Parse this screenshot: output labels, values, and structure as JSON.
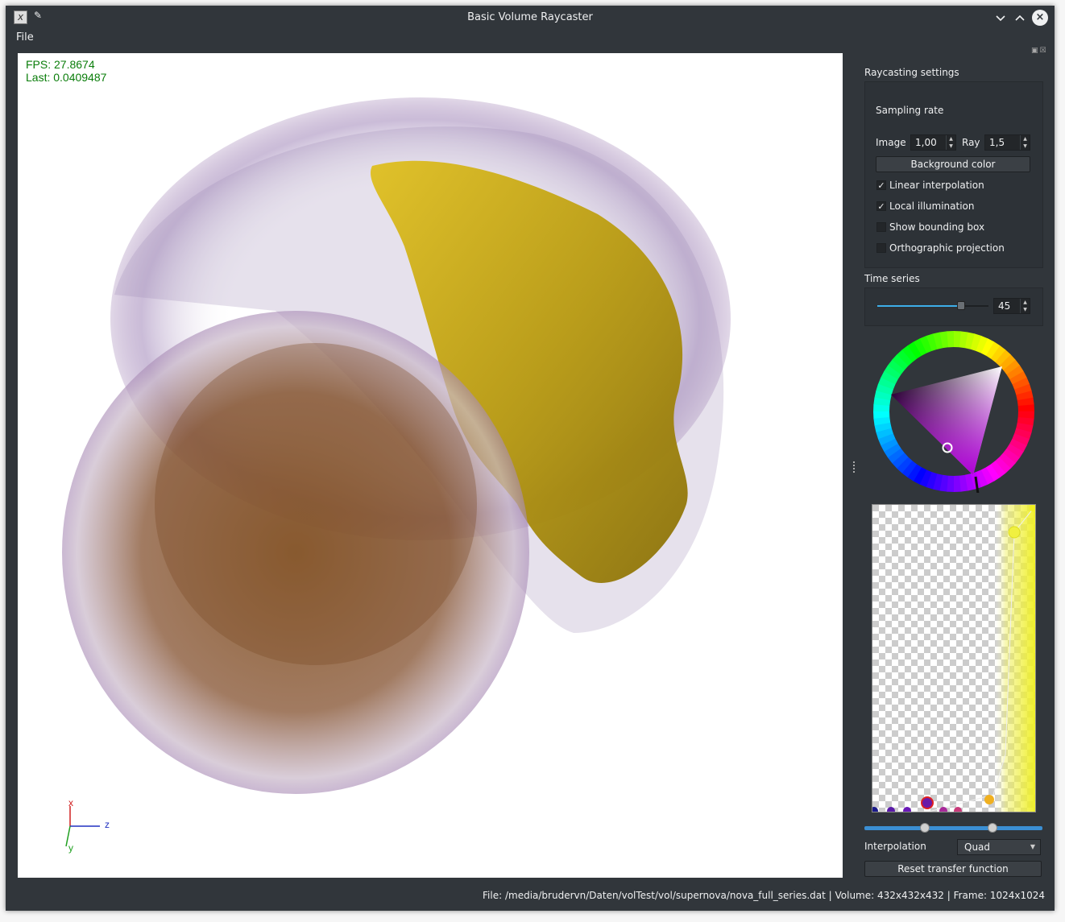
{
  "window": {
    "title": "Basic Volume Raycaster",
    "minimize_glyph": "⌄",
    "maximize_glyph": "⌃",
    "close_glyph": "×"
  },
  "menu": {
    "file": "File"
  },
  "viewport": {
    "fps_line": "FPS: 27.8674",
    "last_line": "Last: 0.0409487",
    "axis_x": "x",
    "axis_y": "y",
    "axis_z": "z"
  },
  "raycasting": {
    "group_title": "Raycasting settings",
    "sampling_rate_label": "Sampling rate",
    "image_label": "Image",
    "image_value": "1,00",
    "ray_label": "Ray",
    "ray_value": "1,5",
    "background_color_button": "Background color",
    "linear_interpolation": {
      "label": "Linear interpolation",
      "checked": true
    },
    "local_illumination": {
      "label": "Local illumination",
      "checked": true
    },
    "show_bounding_box": {
      "label": "Show bounding box",
      "checked": false
    },
    "orthographic_projection": {
      "label": "Orthographic projection",
      "checked": false
    }
  },
  "time_series": {
    "group_title": "Time series",
    "value": "45",
    "slider_fraction": 0.75
  },
  "color_wheel": {
    "selected_hue": "purple",
    "marker_color": "#ffffff"
  },
  "transfer_function": {
    "interpolation_label": "Interpolation",
    "interpolation_value": "Quad",
    "reset_button": "Reset transfer function",
    "range_low": 0.34,
    "range_high": 0.72
  },
  "status": {
    "text": "File: /media/brudervn/Daten/volTest/vol/supernova/nova_full_series.dat | Volume: 432x432x432 | Frame: 1024x1024"
  },
  "colors": {
    "window_bg": "#31363b",
    "fps_text": "#0a7d0a",
    "accent": "#3daee9",
    "volume_purple": "#6a3a8a",
    "volume_gold": "#c8a80a"
  }
}
